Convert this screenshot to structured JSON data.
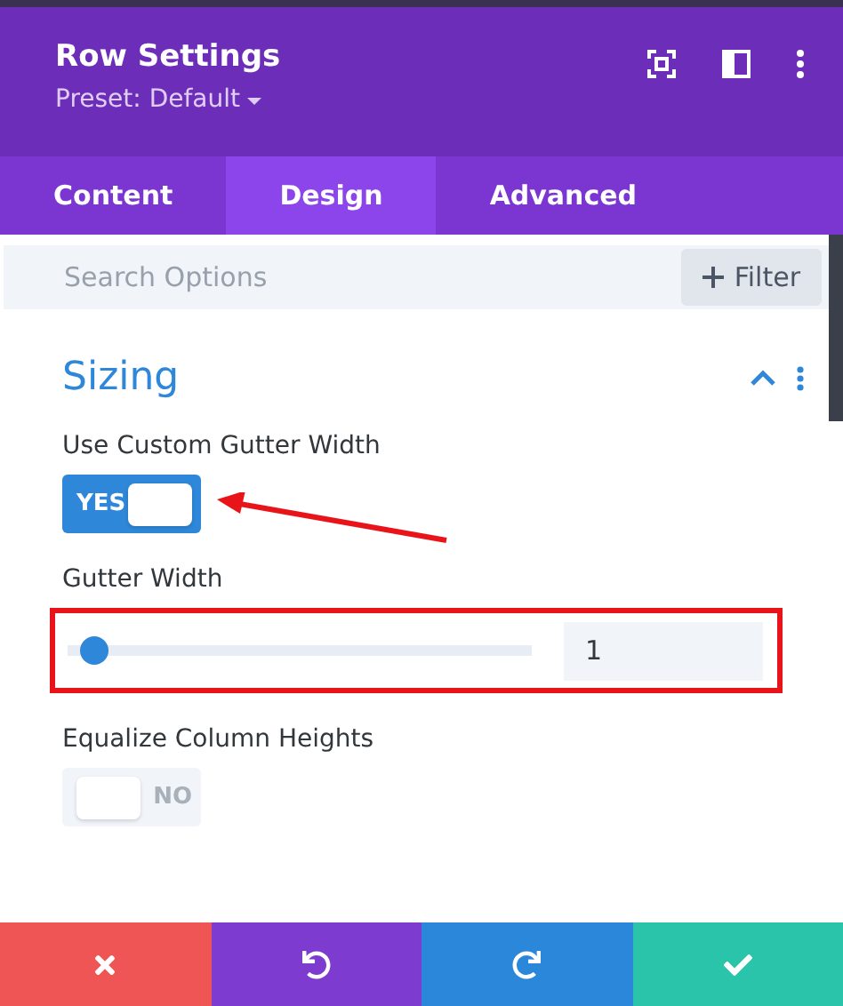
{
  "header": {
    "title": "Row Settings",
    "preset": "Preset: Default"
  },
  "tabs": [
    {
      "label": "Content",
      "selected": false
    },
    {
      "label": "Design",
      "selected": true
    },
    {
      "label": "Advanced",
      "selected": false
    }
  ],
  "search": {
    "placeholder": "Search Options"
  },
  "filter_button": {
    "label": "Filter"
  },
  "section": {
    "title": "Sizing",
    "expanded": true
  },
  "settings": [
    {
      "kind": "toggle",
      "label": "Use Custom Gutter Width",
      "on": true,
      "state_text": "YES",
      "arrow": true
    },
    {
      "kind": "slider",
      "label": "Gutter Width",
      "level": 0.03,
      "value": "1",
      "highlighted": true
    },
    {
      "kind": "toggle",
      "label": "Equalize Column Heights",
      "on": false,
      "state_text": "NO",
      "arrow": false
    }
  ],
  "footer": [
    {
      "kind": "cancel"
    },
    {
      "kind": "undo"
    },
    {
      "kind": "redo"
    },
    {
      "kind": "save"
    }
  ]
}
